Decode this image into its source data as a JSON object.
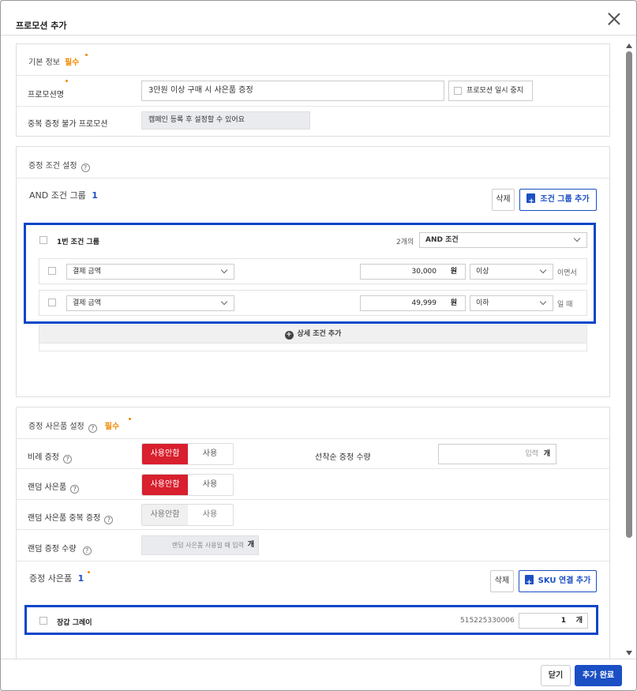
{
  "modal": {
    "title": "프로모션 추가"
  },
  "basic": {
    "title": "기본 정보",
    "required": "필수",
    "name_label": "프로모션명",
    "name_value": "3만원 이상 구매 시 사은품 증정",
    "pause_label": "프로모션 일시 중지",
    "dup_label": "중복 증정 불가 프로모션",
    "dup_value": "캠페인 등록 후 설정할 수 있어요"
  },
  "condition": {
    "title": "증정 조건 설정",
    "group_title": "AND 조건 그룹",
    "group_count": "1",
    "delete_label": "삭제",
    "add_group_label": "조건 그룹 추가",
    "group1": {
      "name": "1번 조건 그룹",
      "count_label": "2개의",
      "type": "AND 조건",
      "rows": [
        {
          "field": "결제 금액",
          "amount": "30,000",
          "unit": "원",
          "op": "이상",
          "suffix": "이면서"
        },
        {
          "field": "결제 금액",
          "amount": "49,999",
          "unit": "원",
          "op": "이하",
          "suffix": "일 때"
        }
      ],
      "add_detail_label": "상세 조건 추가"
    }
  },
  "gift": {
    "title": "증정 사은품 설정",
    "required": "필수",
    "ratio_label": "비례 증정",
    "first_come_label": "선착순 증정 수량",
    "first_come_placeholder": "입력",
    "unit_ea": "개",
    "random_label": "랜덤 사은품",
    "random_dup_label": "랜덤 사은품 중복 증정",
    "random_qty_label": "랜덤 증정 수량",
    "random_qty_placeholder": "랜덤 사은품 사용일 때 입력",
    "off_label": "사용안함",
    "on_label": "사용",
    "items_title": "증정 사은품",
    "items_count": "1",
    "delete_label": "삭제",
    "sku_label": "SKU 연결 추가",
    "items": [
      {
        "name": "장갑 그레이",
        "sku": "515225330006",
        "qty": "1",
        "unit": "개"
      }
    ]
  },
  "footer": {
    "close_label": "닫기",
    "submit_label": "추가 완료"
  },
  "colors": {
    "accent": "#0a46c8",
    "danger": "#d8202e",
    "required": "#f08a00"
  }
}
